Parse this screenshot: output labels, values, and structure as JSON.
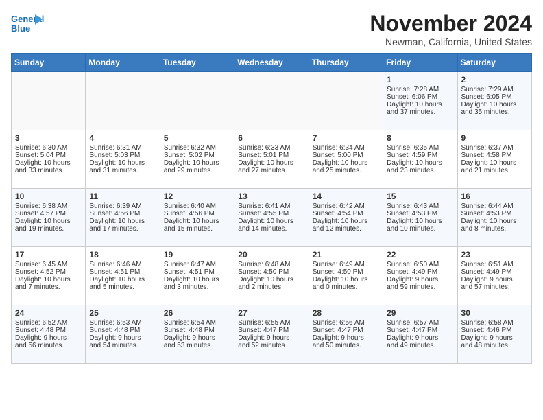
{
  "header": {
    "logo_line1": "General",
    "logo_line2": "Blue",
    "month_title": "November 2024",
    "location": "Newman, California, United States"
  },
  "weekdays": [
    "Sunday",
    "Monday",
    "Tuesday",
    "Wednesday",
    "Thursday",
    "Friday",
    "Saturday"
  ],
  "weeks": [
    [
      {
        "day": "",
        "info": ""
      },
      {
        "day": "",
        "info": ""
      },
      {
        "day": "",
        "info": ""
      },
      {
        "day": "",
        "info": ""
      },
      {
        "day": "",
        "info": ""
      },
      {
        "day": "1",
        "info": "Sunrise: 7:28 AM\nSunset: 6:06 PM\nDaylight: 10 hours\nand 37 minutes."
      },
      {
        "day": "2",
        "info": "Sunrise: 7:29 AM\nSunset: 6:05 PM\nDaylight: 10 hours\nand 35 minutes."
      }
    ],
    [
      {
        "day": "3",
        "info": "Sunrise: 6:30 AM\nSunset: 5:04 PM\nDaylight: 10 hours\nand 33 minutes."
      },
      {
        "day": "4",
        "info": "Sunrise: 6:31 AM\nSunset: 5:03 PM\nDaylight: 10 hours\nand 31 minutes."
      },
      {
        "day": "5",
        "info": "Sunrise: 6:32 AM\nSunset: 5:02 PM\nDaylight: 10 hours\nand 29 minutes."
      },
      {
        "day": "6",
        "info": "Sunrise: 6:33 AM\nSunset: 5:01 PM\nDaylight: 10 hours\nand 27 minutes."
      },
      {
        "day": "7",
        "info": "Sunrise: 6:34 AM\nSunset: 5:00 PM\nDaylight: 10 hours\nand 25 minutes."
      },
      {
        "day": "8",
        "info": "Sunrise: 6:35 AM\nSunset: 4:59 PM\nDaylight: 10 hours\nand 23 minutes."
      },
      {
        "day": "9",
        "info": "Sunrise: 6:37 AM\nSunset: 4:58 PM\nDaylight: 10 hours\nand 21 minutes."
      }
    ],
    [
      {
        "day": "10",
        "info": "Sunrise: 6:38 AM\nSunset: 4:57 PM\nDaylight: 10 hours\nand 19 minutes."
      },
      {
        "day": "11",
        "info": "Sunrise: 6:39 AM\nSunset: 4:56 PM\nDaylight: 10 hours\nand 17 minutes."
      },
      {
        "day": "12",
        "info": "Sunrise: 6:40 AM\nSunset: 4:56 PM\nDaylight: 10 hours\nand 15 minutes."
      },
      {
        "day": "13",
        "info": "Sunrise: 6:41 AM\nSunset: 4:55 PM\nDaylight: 10 hours\nand 14 minutes."
      },
      {
        "day": "14",
        "info": "Sunrise: 6:42 AM\nSunset: 4:54 PM\nDaylight: 10 hours\nand 12 minutes."
      },
      {
        "day": "15",
        "info": "Sunrise: 6:43 AM\nSunset: 4:53 PM\nDaylight: 10 hours\nand 10 minutes."
      },
      {
        "day": "16",
        "info": "Sunrise: 6:44 AM\nSunset: 4:53 PM\nDaylight: 10 hours\nand 8 minutes."
      }
    ],
    [
      {
        "day": "17",
        "info": "Sunrise: 6:45 AM\nSunset: 4:52 PM\nDaylight: 10 hours\nand 7 minutes."
      },
      {
        "day": "18",
        "info": "Sunrise: 6:46 AM\nSunset: 4:51 PM\nDaylight: 10 hours\nand 5 minutes."
      },
      {
        "day": "19",
        "info": "Sunrise: 6:47 AM\nSunset: 4:51 PM\nDaylight: 10 hours\nand 3 minutes."
      },
      {
        "day": "20",
        "info": "Sunrise: 6:48 AM\nSunset: 4:50 PM\nDaylight: 10 hours\nand 2 minutes."
      },
      {
        "day": "21",
        "info": "Sunrise: 6:49 AM\nSunset: 4:50 PM\nDaylight: 10 hours\nand 0 minutes."
      },
      {
        "day": "22",
        "info": "Sunrise: 6:50 AM\nSunset: 4:49 PM\nDaylight: 9 hours\nand 59 minutes."
      },
      {
        "day": "23",
        "info": "Sunrise: 6:51 AM\nSunset: 4:49 PM\nDaylight: 9 hours\nand 57 minutes."
      }
    ],
    [
      {
        "day": "24",
        "info": "Sunrise: 6:52 AM\nSunset: 4:48 PM\nDaylight: 9 hours\nand 56 minutes."
      },
      {
        "day": "25",
        "info": "Sunrise: 6:53 AM\nSunset: 4:48 PM\nDaylight: 9 hours\nand 54 minutes."
      },
      {
        "day": "26",
        "info": "Sunrise: 6:54 AM\nSunset: 4:48 PM\nDaylight: 9 hours\nand 53 minutes."
      },
      {
        "day": "27",
        "info": "Sunrise: 6:55 AM\nSunset: 4:47 PM\nDaylight: 9 hours\nand 52 minutes."
      },
      {
        "day": "28",
        "info": "Sunrise: 6:56 AM\nSunset: 4:47 PM\nDaylight: 9 hours\nand 50 minutes."
      },
      {
        "day": "29",
        "info": "Sunrise: 6:57 AM\nSunset: 4:47 PM\nDaylight: 9 hours\nand 49 minutes."
      },
      {
        "day": "30",
        "info": "Sunrise: 6:58 AM\nSunset: 4:46 PM\nDaylight: 9 hours\nand 48 minutes."
      }
    ]
  ]
}
